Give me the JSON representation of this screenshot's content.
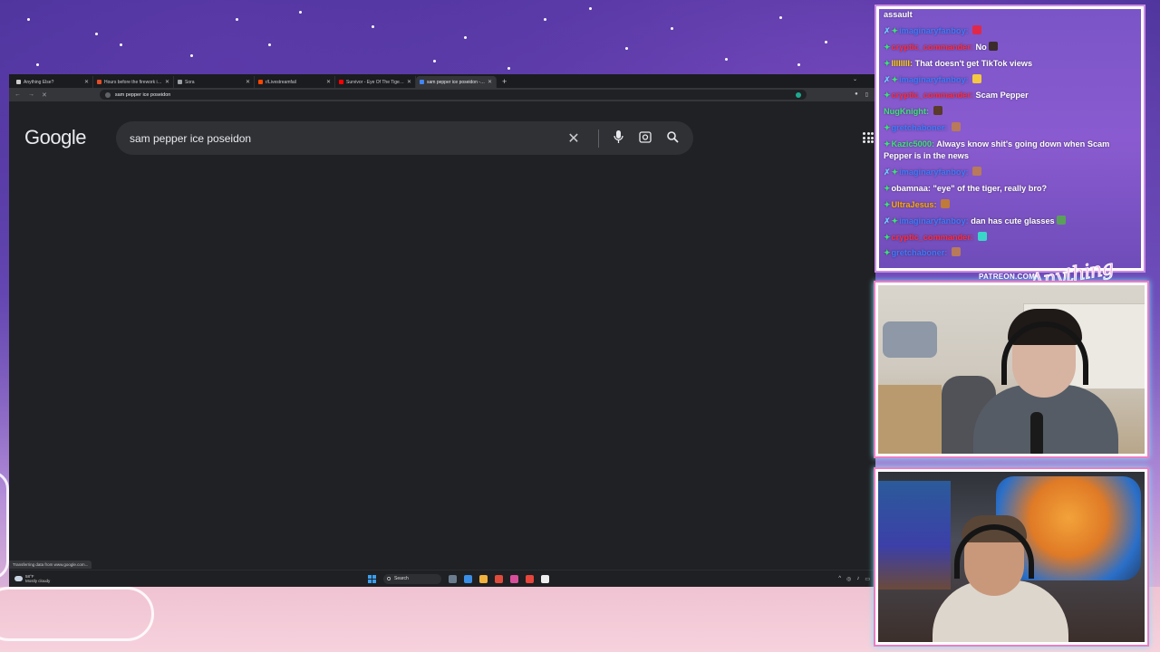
{
  "browser": {
    "tabs": [
      {
        "title": "Anything Else?",
        "favicon_color": "#cccccc",
        "active": false
      },
      {
        "title": "Hours before the firework incid",
        "favicon_color": "#e34c26",
        "active": false
      },
      {
        "title": "Sora",
        "favicon_color": "#9aa0a6",
        "active": false
      },
      {
        "title": "r/Livestreamfail",
        "favicon_color": "#ff4500",
        "active": false
      },
      {
        "title": "Survivor - Eye Of The Tiger (Of",
        "favicon_color": "#ff0000",
        "active": false
      },
      {
        "title": "sam pepper ice poseidon - G",
        "favicon_color": "#4285f4",
        "active": true
      }
    ],
    "new_tab_label": "+",
    "address": "sam pepper ice poseidon",
    "status_tooltip": "Transferring data from www.google.com..."
  },
  "google": {
    "logo": "Google",
    "query": "sam pepper ice poseidon"
  },
  "taskbar": {
    "weather_temp": "58°F",
    "weather_desc": "Mostly cloudy",
    "search_label": "Search",
    "app_colors": [
      "#6b7c8f",
      "#3a8ee6",
      "#f2b33d",
      "#e14b3b",
      "#d94e9b",
      "#e8453c",
      "#eeeeee"
    ]
  },
  "chat": {
    "messages": [
      {
        "user": "",
        "user_color": "#ffffff",
        "text": "assault",
        "badges": 0,
        "emote": ""
      },
      {
        "user": "imaginaryfanboy:",
        "user_color": "#3d7bff",
        "text": "",
        "badges": 2,
        "emote": "#e0294a"
      },
      {
        "user": "cryptic_commander:",
        "user_color": "#ff2b3d",
        "text": "No",
        "badges": 1,
        "emote": "#3b2b2b"
      },
      {
        "user": "llllllll:",
        "user_color": "#ffd400",
        "text": "That doesn't get TikTok views",
        "badges": 1,
        "emote": ""
      },
      {
        "user": "imaginaryfanboy:",
        "user_color": "#3d7bff",
        "text": "",
        "badges": 2,
        "emote": "#f5c842"
      },
      {
        "user": "cryptic_commander:",
        "user_color": "#ff2b3d",
        "text": "Scam Pepper",
        "badges": 1,
        "emote": ""
      },
      {
        "user": "NugKnight:",
        "user_color": "#3ee07a",
        "text": "",
        "badges": 0,
        "emote": "#5a3a2a"
      },
      {
        "user": "gretchaboner:",
        "user_color": "#3d7bff",
        "text": "",
        "badges": 1,
        "emote": "#b87a5a"
      },
      {
        "user": "Kazic5000:",
        "user_color": "#3ee07a",
        "text": "Always know shit's going down when Scam Pepper is in the news",
        "badges": 1,
        "emote": ""
      },
      {
        "user": "imaginaryfanboy:",
        "user_color": "#3d7bff",
        "text": "",
        "badges": 2,
        "emote": "#b87a5a"
      },
      {
        "user": "obamnaa:",
        "user_color": "#ffffff",
        "text": "\"eye\" of the tiger, really bro?",
        "badges": 1,
        "emote": ""
      },
      {
        "user": "UltraJesus:",
        "user_color": "#ffaa00",
        "text": "",
        "badges": 1,
        "emote": "#c07a3a"
      },
      {
        "user": "imaginaryfanboy:",
        "user_color": "#3d7bff",
        "text": "dan has cute glasses",
        "badges": 2,
        "emote": "#5aa05a"
      },
      {
        "user": "cryptic_commander:",
        "user_color": "#ff2b3d",
        "text": "",
        "badges": 1,
        "emote": "#3ad6c9"
      },
      {
        "user": "gretchaboner:",
        "user_color": "#3d7bff",
        "text": "",
        "badges": 1,
        "emote": "#b87a5a"
      }
    ]
  },
  "overlay": {
    "patreon": "PATREON.COM/",
    "logo": "Anything Else?"
  }
}
